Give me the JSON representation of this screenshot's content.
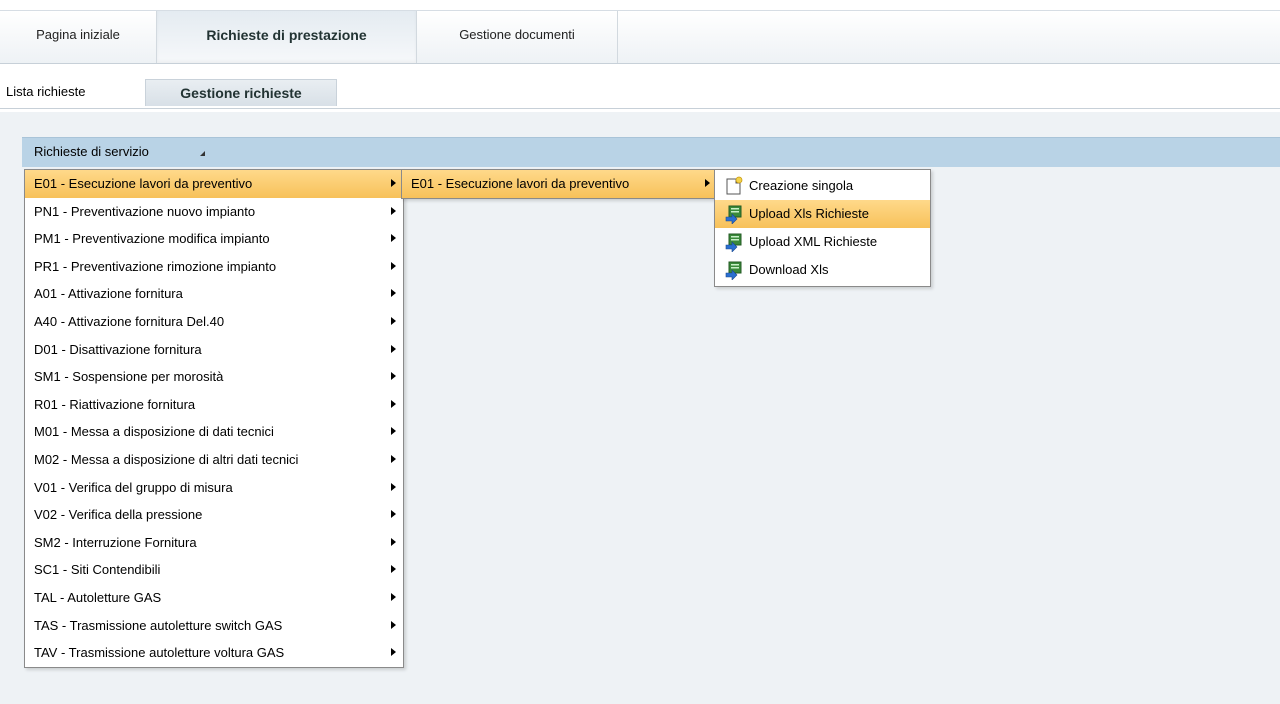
{
  "tabs": [
    {
      "label": "Pagina iniziale"
    },
    {
      "label": "Richieste di prestazione"
    },
    {
      "label": "Gestione documenti"
    }
  ],
  "subtabs": [
    {
      "label": "Lista richieste"
    },
    {
      "label": "Gestione richieste"
    }
  ],
  "menu_bar": {
    "label": "Richieste di servizio"
  },
  "menu_level1": [
    {
      "label": "E01 - Esecuzione lavori da preventivo"
    },
    {
      "label": "PN1 - Preventivazione nuovo impianto"
    },
    {
      "label": "PM1 - Preventivazione modifica impianto"
    },
    {
      "label": "PR1 - Preventivazione rimozione impianto"
    },
    {
      "label": "A01 - Attivazione fornitura"
    },
    {
      "label": "A40 - Attivazione fornitura Del.40"
    },
    {
      "label": "D01 - Disattivazione fornitura"
    },
    {
      "label": "SM1 - Sospensione per morosità"
    },
    {
      "label": "R01 - Riattivazione fornitura"
    },
    {
      "label": "M01 - Messa a disposizione di dati tecnici"
    },
    {
      "label": "M02 - Messa a disposizione di altri dati tecnici"
    },
    {
      "label": "V01 - Verifica del gruppo di misura"
    },
    {
      "label": "V02 - Verifica della pressione"
    },
    {
      "label": "SM2 - Interruzione Fornitura"
    },
    {
      "label": "SC1 - Siti Contendibili"
    },
    {
      "label": "TAL - Autoletture GAS"
    },
    {
      "label": "TAS - Trasmissione autoletture switch GAS"
    },
    {
      "label": "TAV - Trasmissione autoletture voltura GAS"
    }
  ],
  "menu_level2": [
    {
      "label": "E01 - Esecuzione lavori da preventivo"
    }
  ],
  "menu_level3": [
    {
      "label": "Creazione singola",
      "icon": "new-document-icon"
    },
    {
      "label": "Upload Xls Richieste",
      "icon": "upload-icon"
    },
    {
      "label": "Upload XML Richieste",
      "icon": "upload-icon"
    },
    {
      "label": "Download Xls",
      "icon": "download-icon"
    }
  ],
  "colors": {
    "highlight": "#f7c15a",
    "header_bar": "#b9d3e6",
    "background": "#eef2f5"
  }
}
